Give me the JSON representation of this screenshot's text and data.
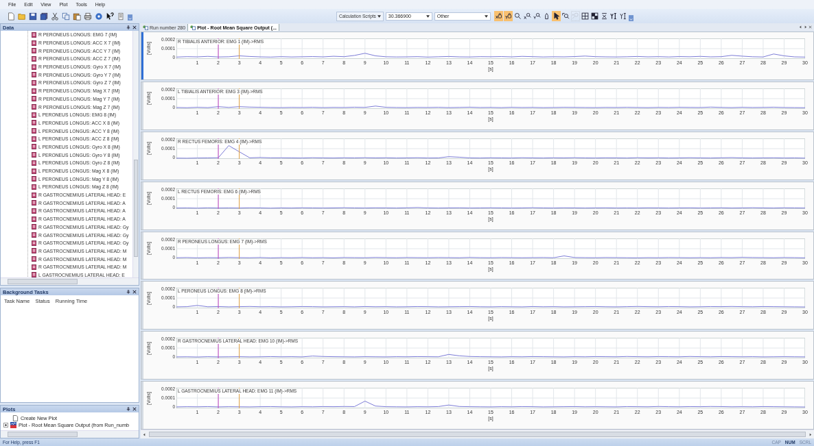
{
  "menu": [
    "File",
    "Edit",
    "View",
    "Plot",
    "Tools",
    "Help"
  ],
  "toolbar": {
    "calc_button": "Calculation Scripts",
    "value_field": "30.366900",
    "dropdown": "Other",
    "tools": [
      {
        "kind": "x-lock",
        "selected": true,
        "disabled": false
      },
      {
        "kind": "y-lock",
        "selected": true,
        "disabled": false
      },
      {
        "kind": "zoom",
        "selected": false,
        "disabled": false
      },
      {
        "kind": "x-zoom",
        "selected": false,
        "disabled": false
      },
      {
        "kind": "y-zoom",
        "selected": false,
        "disabled": false
      },
      {
        "kind": "marker",
        "selected": false,
        "disabled": false
      },
      {
        "kind": "pointer",
        "selected": true,
        "disabled": false
      },
      {
        "kind": "zoom-box",
        "selected": false,
        "disabled": false
      },
      {
        "kind": "zoom-reset",
        "selected": false,
        "disabled": true
      },
      {
        "kind": "grid",
        "selected": false,
        "disabled": false
      },
      {
        "kind": "grid-fill",
        "selected": false,
        "disabled": false
      },
      {
        "kind": "cross",
        "selected": false,
        "disabled": false
      },
      {
        "kind": "y-scale",
        "selected": false,
        "disabled": false
      },
      {
        "kind": "y-scale-alt",
        "selected": false,
        "disabled": false
      }
    ]
  },
  "panels": {
    "data": {
      "title": "Data",
      "items": [
        "R PERONEUS LONGUS: EMG 7 (IM)",
        "R PERONEUS LONGUS: ACC X 7 (IM)",
        "R PERONEUS LONGUS: ACC Y 7 (IM)",
        "R PERONEUS LONGUS: ACC Z 7 (IM)",
        "R PERONEUS LONGUS: Gyro X 7 (IM)",
        "R PERONEUS LONGUS: Gyro Y 7 (IM)",
        "R PERONEUS LONGUS: Gyro Z 7 (IM)",
        "R PERONEUS LONGUS: Mag X 7 (IM)",
        "R PERONEUS LONGUS: Mag Y 7 (IM)",
        "R PERONEUS LONGUS: Mag Z 7 (IM)",
        "L PERONEUS LONGUS: EMG 8 (IM)",
        "L PERONEUS LONGUS: ACC X 8 (IM)",
        "L PERONEUS LONGUS: ACC Y 8 (IM)",
        "L PERONEUS LONGUS: ACC Z 8 (IM)",
        "L PERONEUS LONGUS: Gyro X 8 (IM)",
        "L PERONEUS LONGUS: Gyro Y 8 (IM)",
        "L PERONEUS LONGUS: Gyro Z 8 (IM)",
        "L PERONEUS LONGUS: Mag X 8 (IM)",
        "L PERONEUS LONGUS: Mag Y 8 (IM)",
        "L PERONEUS LONGUS: Mag Z 8 (IM)",
        "R GASTROCNEMIUS LATERAL HEAD: E",
        "R GASTROCNEMIUS LATERAL HEAD: A",
        "R GASTROCNEMIUS LATERAL HEAD: A",
        "R GASTROCNEMIUS LATERAL HEAD: A",
        "R GASTROCNEMIUS LATERAL HEAD: Gy",
        "R GASTROCNEMIUS LATERAL HEAD: Gy",
        "R GASTROCNEMIUS LATERAL HEAD: Gy",
        "R GASTROCNEMIUS LATERAL HEAD: M",
        "R GASTROCNEMIUS LATERAL HEAD: M",
        "R GASTROCNEMIUS LATERAL HEAD: M",
        "L GASTROCNEMIUS LATERAL HEAD: E"
      ]
    },
    "background_tasks": {
      "title": "Background Tasks",
      "columns": [
        "Task Name",
        "Status",
        "Running Time"
      ]
    },
    "plots": {
      "title": "Plots",
      "items": [
        {
          "label": "Create New Plot",
          "kind": "new"
        },
        {
          "label": "Plot - Root Mean Square Output (from Run_numb",
          "kind": "plot"
        }
      ]
    }
  },
  "tabs": [
    {
      "label": "Run number 280",
      "selected": false
    },
    {
      "label": "Plot - Root Mean Square Output (...",
      "selected": true
    }
  ],
  "plots": [
    {
      "selected": true,
      "chart_data": {
        "type": "line",
        "grid": true,
        "xlabel": "[s]",
        "ylabel": "[Volts]",
        "xlim": [
          0,
          30
        ],
        "ylim": [
          0,
          0.0002
        ],
        "xticks": [
          1,
          2,
          3,
          4,
          5,
          6,
          7,
          8,
          9,
          10,
          11,
          12,
          13,
          14,
          15,
          16,
          17,
          18,
          19,
          20,
          21,
          22,
          23,
          24,
          25,
          26,
          27,
          28,
          29,
          30
        ],
        "yticks": [
          0,
          0.0001,
          0.0002
        ],
        "x": [
          0,
          0.5,
          1,
          1.5,
          2,
          2.5,
          3,
          3.5,
          4,
          4.5,
          5,
          5.5,
          6,
          6.5,
          7,
          7.5,
          8,
          8.5,
          9,
          9.5,
          10,
          10.5,
          11,
          11.5,
          12,
          12.5,
          13,
          13.5,
          14,
          14.5,
          15,
          15.5,
          16,
          16.5,
          17,
          17.5,
          18,
          18.5,
          19,
          19.5,
          20,
          20.5,
          21,
          21.5,
          22,
          22.5,
          23,
          23.5,
          24,
          24.5,
          25,
          25.5,
          26,
          26.5,
          27,
          27.5,
          28,
          28.5,
          29,
          29.5,
          30
        ],
        "series": [
          {
            "name": "R TIBIALIS ANTERIOR: EMG 1 (IM)->RMS",
            "color": "#7b7bd6",
            "values": [
              1.8e-05,
              2.2e-05,
              2e-05,
              2.5e-05,
              1.9e-05,
              2.1e-05,
              3e-05,
              2.4e-05,
              2e-05,
              1.8e-05,
              2.2e-05,
              1.9e-05,
              2.1e-05,
              2.3e-05,
              2e-05,
              2.6e-05,
              2.2e-05,
              3.4e-05,
              5.5e-05,
              3e-05,
              2.1e-05,
              1.9e-05,
              2e-05,
              2.2e-05,
              1.8e-05,
              2.1e-05,
              2.4e-05,
              2e-05,
              1.9e-05,
              2.2e-05,
              2.1e-05,
              2.3e-05,
              2e-05,
              2.5e-05,
              2.2e-05,
              1.9e-05,
              2.1e-05,
              2e-05,
              2.3e-05,
              2.8e-05,
              2.2e-05,
              2e-05,
              1.9e-05,
              2.1e-05,
              2.4e-05,
              2e-05,
              2.2e-05,
              1.9e-05,
              2.3e-05,
              2.1e-05,
              2.5e-05,
              2e-05,
              2.2e-05,
              3.5e-05,
              2.7e-05,
              2.1e-05,
              1.9e-05,
              4.8e-05,
              3e-05,
              2e-05,
              1.8e-05
            ]
          }
        ]
      }
    },
    {
      "selected": false,
      "chart_data": {
        "type": "line",
        "xlabel": "[s]",
        "ylabel": "[Volts]",
        "xlim": [
          0,
          30
        ],
        "ylim": [
          0,
          0.0002
        ],
        "xticks": [
          1,
          2,
          3,
          4,
          5,
          6,
          7,
          8,
          9,
          10,
          11,
          12,
          13,
          14,
          15,
          16,
          17,
          18,
          19,
          20,
          21,
          22,
          23,
          24,
          25,
          26,
          27,
          28,
          29,
          30
        ],
        "yticks": [
          0,
          0.0001,
          0.0002
        ],
        "x": [
          0,
          0.5,
          1,
          1.5,
          2,
          2.5,
          3,
          3.5,
          4,
          4.5,
          5,
          5.5,
          6,
          6.5,
          7,
          7.5,
          8,
          8.5,
          9,
          9.5,
          10,
          10.5,
          11,
          11.5,
          12,
          12.5,
          13,
          13.5,
          14,
          14.5,
          15,
          15.5,
          16,
          16.5,
          17,
          17.5,
          18,
          18.5,
          19,
          19.5,
          20,
          20.5,
          21,
          21.5,
          22,
          22.5,
          23,
          23.5,
          24,
          24.5,
          25,
          25.5,
          26,
          26.5,
          27,
          27.5,
          28,
          28.5,
          29,
          29.5,
          30
        ],
        "grid": true,
        "series": [
          {
            "name": "L TIBIALIS ANTERIOR: EMG 3 (IM)->RMS",
            "color": "#7b7bd6",
            "values": [
              1.4e-05,
              1.2e-05,
              1.6e-05,
              1.3e-05,
              2.2e-05,
              1.5e-05,
              2.2e-05,
              1.8e-05,
              1.6e-05,
              1.4e-05,
              1.3e-05,
              1.5e-05,
              1.4e-05,
              1.6e-05,
              1.3e-05,
              1.5e-05,
              1.4e-05,
              1.7e-05,
              1.5e-05,
              2.8e-05,
              1.6e-05,
              1.4e-05,
              1.3e-05,
              1.5e-05,
              1.4e-05,
              1.6e-05,
              1.3e-05,
              1.5e-05,
              1.7e-05,
              1.4e-05,
              1.5e-05,
              1.3e-05,
              1.6e-05,
              1.4e-05,
              1.5e-05,
              1.3e-05,
              1.4e-05,
              1.6e-05,
              1.5e-05,
              1.4e-05,
              1.3e-05,
              1.5e-05,
              1.4e-05,
              1.6e-05,
              1.4e-05,
              1.3e-05,
              1.5e-05,
              1.4e-05,
              1.6e-05,
              1.5e-05,
              1.4e-05,
              1.8e-05,
              1.5e-05,
              1.3e-05,
              1.6e-05,
              1.4e-05,
              1.5e-05,
              1.7e-05,
              1.4e-05,
              1.3e-05,
              1.2e-05
            ]
          }
        ]
      }
    },
    {
      "selected": false,
      "chart_data": {
        "type": "line",
        "xlabel": "[s]",
        "ylabel": "[Volts]",
        "xlim": [
          0,
          30
        ],
        "ylim": [
          0,
          0.0002
        ],
        "xticks": [
          1,
          2,
          3,
          4,
          5,
          6,
          7,
          8,
          9,
          10,
          11,
          12,
          13,
          14,
          15,
          16,
          17,
          18,
          19,
          20,
          21,
          22,
          23,
          24,
          25,
          26,
          27,
          28,
          29,
          30
        ],
        "yticks": [
          0,
          0.0001,
          0.0002
        ],
        "x": [
          0,
          0.5,
          1,
          1.5,
          2,
          2.5,
          3,
          3.5,
          4,
          4.5,
          5,
          5.5,
          6,
          6.5,
          7,
          7.5,
          8,
          8.5,
          9,
          9.5,
          10,
          10.5,
          11,
          11.5,
          12,
          12.5,
          13,
          13.5,
          14,
          14.5,
          15,
          15.5,
          16,
          16.5,
          17,
          17.5,
          18,
          18.5,
          19,
          19.5,
          20,
          20.5,
          21,
          21.5,
          22,
          22.5,
          23,
          23.5,
          24,
          24.5,
          25,
          25.5,
          26,
          26.5,
          27,
          27.5,
          28,
          28.5,
          29,
          29.5,
          30
        ],
        "grid": true,
        "series": [
          {
            "name": "R RECTUS FEMORIS: EMG 4 (IM)->RMS",
            "color": "#7b7bd6",
            "values": [
              8e-06,
              7e-06,
              9e-06,
              1e-05,
              1.2e-05,
              0.00013,
              7e-05,
              1.1e-05,
              1.4e-05,
              1.1e-05,
              1.1e-05,
              1e-05,
              9e-06,
              1.2e-05,
              1e-05,
              9e-06,
              1.1e-05,
              1e-05,
              1.2e-05,
              1e-05,
              1.1e-05,
              9e-06,
              1e-05,
              1.2e-05,
              9e-06,
              1e-05,
              2.2e-05,
              1.7e-05,
              1e-05,
              9e-06,
              1.1e-05,
              1e-05,
              9e-06,
              1.2e-05,
              1e-05,
              9e-06,
              1.1e-05,
              1e-05,
              1.2e-05,
              1e-05,
              9e-06,
              1.1e-05,
              1e-05,
              9e-06,
              1.2e-05,
              1e-05,
              1.1e-05,
              9e-06,
              1e-05,
              1.2e-05,
              1e-05,
              9e-06,
              1.1e-05,
              1.3e-05,
              1e-05,
              9e-06,
              1e-05,
              1.1e-05,
              9e-06,
              1e-05,
              8e-06
            ]
          }
        ]
      }
    },
    {
      "selected": false,
      "chart_data": {
        "type": "line",
        "xlabel": "[s]",
        "ylabel": "[Volts]",
        "xlim": [
          0,
          30
        ],
        "ylim": [
          0,
          0.0002
        ],
        "xticks": [
          1,
          2,
          3,
          4,
          5,
          6,
          7,
          8,
          9,
          10,
          11,
          12,
          13,
          14,
          15,
          16,
          17,
          18,
          19,
          20,
          21,
          22,
          23,
          24,
          25,
          26,
          27,
          28,
          29,
          30
        ],
        "yticks": [
          0,
          0.0001,
          0.0002
        ],
        "x": [
          0,
          0.5,
          1,
          1.5,
          2,
          2.5,
          3,
          3.5,
          4,
          4.5,
          5,
          5.5,
          6,
          6.5,
          7,
          7.5,
          8,
          8.5,
          9,
          9.5,
          10,
          10.5,
          11,
          11.5,
          12,
          12.5,
          13,
          13.5,
          14,
          14.5,
          15,
          15.5,
          16,
          16.5,
          17,
          17.5,
          18,
          18.5,
          19,
          19.5,
          20,
          20.5,
          21,
          21.5,
          22,
          22.5,
          23,
          23.5,
          24,
          24.5,
          25,
          25.5,
          26,
          26.5,
          27,
          27.5,
          28,
          28.5,
          29,
          29.5,
          30
        ],
        "grid": true,
        "series": [
          {
            "name": "L RECTUS FEMORIS: EMG 6 (IM)->RMS",
            "color": "#7b7bd6",
            "values": [
              9e-06,
              1e-05,
              8e-06,
              1.1e-05,
              9e-06,
              1e-05,
              9e-06,
              1.1e-05,
              1e-05,
              8e-06,
              1e-05,
              9e-06,
              1.1e-05,
              1e-05,
              9e-06,
              1e-05,
              1.2e-05,
              1e-05,
              9e-06,
              1.1e-05,
              1e-05,
              9e-06,
              1.1e-05,
              1.4e-05,
              1e-05,
              9e-06,
              1e-05,
              1.1e-05,
              9e-06,
              1e-05,
              1.1e-05,
              1e-05,
              9e-06,
              1e-05,
              1.2e-05,
              1e-05,
              9e-06,
              1.1e-05,
              1e-05,
              9e-06,
              1e-05,
              1.1e-05,
              9e-06,
              1e-05,
              9e-06,
              1.1e-05,
              1e-05,
              9e-06,
              1e-05,
              1.1e-05,
              9e-06,
              1e-05,
              1.1e-05,
              9e-06,
              1e-05,
              1.2e-05,
              1e-05,
              9e-06,
              1.1e-05,
              1e-05,
              9e-06
            ]
          }
        ]
      }
    },
    {
      "selected": false,
      "chart_data": {
        "type": "line",
        "xlabel": "[s]",
        "ylabel": "[Volts]",
        "xlim": [
          0,
          30
        ],
        "ylim": [
          0,
          0.0002
        ],
        "xticks": [
          1,
          2,
          3,
          4,
          5,
          6,
          7,
          8,
          9,
          10,
          11,
          12,
          13,
          14,
          15,
          16,
          17,
          18,
          19,
          20,
          21,
          22,
          23,
          24,
          25,
          26,
          27,
          28,
          29,
          30
        ],
        "yticks": [
          0,
          0.0001,
          0.0002
        ],
        "x": [
          0,
          0.5,
          1,
          1.5,
          2,
          2.5,
          3,
          3.5,
          4,
          4.5,
          5,
          5.5,
          6,
          6.5,
          7,
          7.5,
          8,
          8.5,
          9,
          9.5,
          10,
          10.5,
          11,
          11.5,
          12,
          12.5,
          13,
          13.5,
          14,
          14.5,
          15,
          15.5,
          16,
          16.5,
          17,
          17.5,
          18,
          18.5,
          19,
          19.5,
          20,
          20.5,
          21,
          21.5,
          22,
          22.5,
          23,
          23.5,
          24,
          24.5,
          25,
          25.5,
          26,
          26.5,
          27,
          27.5,
          28,
          28.5,
          29,
          29.5,
          30
        ],
        "grid": true,
        "series": [
          {
            "name": "R PERONEUS LONGUS: EMG 7 (IM)->RMS",
            "color": "#7b7bd6",
            "values": [
              1.2e-05,
              1.4e-05,
              1.1e-05,
              1.3e-05,
              1.2e-05,
              1.5e-05,
              1.3e-05,
              1.2e-05,
              1.4e-05,
              1.1e-05,
              1.3e-05,
              1.2e-05,
              1.4e-05,
              1.2e-05,
              1.3e-05,
              1.1e-05,
              1.4e-05,
              1.3e-05,
              1.2e-05,
              1.5e-05,
              1.3e-05,
              1.2e-05,
              1.4e-05,
              1.3e-05,
              1.2e-05,
              1.4e-05,
              1.3e-05,
              1.2e-05,
              1.5e-05,
              1.3e-05,
              1.2e-05,
              1.4e-05,
              1.3e-05,
              1.2e-05,
              1.3e-05,
              1.4e-05,
              1.2e-05,
              3e-05,
              1.4e-05,
              1.3e-05,
              1.2e-05,
              1.4e-05,
              1.3e-05,
              1.2e-05,
              1.1e-05,
              1.3e-05,
              1.2e-05,
              1.4e-05,
              1.3e-05,
              1.2e-05,
              1.3e-05,
              1.2e-05,
              1.4e-05,
              1.3e-05,
              1.6e-05,
              1.4e-05,
              1.3e-05,
              1.2e-05,
              1.4e-05,
              1.3e-05,
              1.1e-05
            ]
          }
        ]
      }
    },
    {
      "selected": false,
      "chart_data": {
        "type": "line",
        "xlabel": "[s]",
        "ylabel": "[Volts]",
        "xlim": [
          0,
          30
        ],
        "ylim": [
          0,
          0.0002
        ],
        "xticks": [
          1,
          2,
          3,
          4,
          5,
          6,
          7,
          8,
          9,
          10,
          11,
          12,
          13,
          14,
          15,
          16,
          17,
          18,
          19,
          20,
          21,
          22,
          23,
          24,
          25,
          26,
          27,
          28,
          29,
          30
        ],
        "yticks": [
          0,
          0.0001,
          0.0002
        ],
        "x": [
          0,
          0.5,
          1,
          1.5,
          2,
          2.5,
          3,
          3.5,
          4,
          4.5,
          5,
          5.5,
          6,
          6.5,
          7,
          7.5,
          8,
          8.5,
          9,
          9.5,
          10,
          10.5,
          11,
          11.5,
          12,
          12.5,
          13,
          13.5,
          14,
          14.5,
          15,
          15.5,
          16,
          16.5,
          17,
          17.5,
          18,
          18.5,
          19,
          19.5,
          20,
          20.5,
          21,
          21.5,
          22,
          22.5,
          23,
          23.5,
          24,
          24.5,
          25,
          25.5,
          26,
          26.5,
          27,
          27.5,
          28,
          28.5,
          29,
          29.5,
          30
        ],
        "grid": true,
        "series": [
          {
            "name": "L PERONEUS LONGUS: EMG 8 (IM)->RMS",
            "color": "#7b7bd6",
            "values": [
              1.4e-05,
              1.6e-05,
              2.8e-05,
              1.5e-05,
              1.7e-05,
              1.4e-05,
              1.6e-05,
              1.8e-05,
              1.5e-05,
              1.6e-05,
              1.4e-05,
              1.5e-05,
              1.7e-05,
              1.6e-05,
              1.4e-05,
              1.5e-05,
              1.6e-05,
              1.4e-05,
              1.7e-05,
              1.5e-05,
              1.6e-05,
              1.4e-05,
              1.5e-05,
              1.7e-05,
              1.6e-05,
              1.4e-05,
              1.5e-05,
              1.6e-05,
              1.7e-05,
              1.5e-05,
              1.4e-05,
              1.6e-05,
              1.5e-05,
              1.4e-05,
              1.7e-05,
              1.5e-05,
              1.6e-05,
              1.4e-05,
              1.5e-05,
              1.6e-05,
              1.7e-05,
              1.5e-05,
              1.4e-05,
              1.6e-05,
              1.8e-05,
              1.6e-05,
              1.5e-05,
              1.7e-05,
              1.6e-05,
              1.4e-05,
              1.5e-05,
              1.7e-05,
              1.6e-05,
              1.8e-05,
              1.6e-05,
              1.5e-05,
              1.7e-05,
              1.6e-05,
              1.5e-05,
              1.4e-05,
              1.3e-05
            ]
          }
        ]
      }
    },
    {
      "selected": false,
      "chart_data": {
        "type": "line",
        "xlabel": "[s]",
        "ylabel": "[Volts]",
        "xlim": [
          0,
          30
        ],
        "ylim": [
          0,
          0.0002
        ],
        "xticks": [
          1,
          2,
          3,
          4,
          5,
          6,
          7,
          8,
          9,
          10,
          11,
          12,
          13,
          14,
          15,
          16,
          17,
          18,
          19,
          20,
          21,
          22,
          23,
          24,
          25,
          26,
          27,
          28,
          29,
          30
        ],
        "yticks": [
          0,
          0.0001,
          0.0002
        ],
        "x": [
          0,
          0.5,
          1,
          1.5,
          2,
          2.5,
          3,
          3.5,
          4,
          4.5,
          5,
          5.5,
          6,
          6.5,
          7,
          7.5,
          8,
          8.5,
          9,
          9.5,
          10,
          10.5,
          11,
          11.5,
          12,
          12.5,
          13,
          13.5,
          14,
          14.5,
          15,
          15.5,
          16,
          16.5,
          17,
          17.5,
          18,
          18.5,
          19,
          19.5,
          20,
          20.5,
          21,
          21.5,
          22,
          22.5,
          23,
          23.5,
          24,
          24.5,
          25,
          25.5,
          26,
          26.5,
          27,
          27.5,
          28,
          28.5,
          29,
          29.5,
          30
        ],
        "grid": true,
        "series": [
          {
            "name": "R GASTROCNEMIUS LATERAL HEAD: EMG 10 (IM)->RMS",
            "color": "#7b7bd6",
            "values": [
              1.4e-05,
              1.5e-05,
              1.3e-05,
              1.6e-05,
              1.4e-05,
              1.5e-05,
              1.6e-05,
              1.4e-05,
              1.5e-05,
              1.7e-05,
              1.5e-05,
              1.6e-05,
              1.4e-05,
              2.2e-05,
              1.8e-05,
              1.6e-05,
              1.5e-05,
              1.4e-05,
              1.6e-05,
              1.5e-05,
              1.4e-05,
              1.6e-05,
              1.5e-05,
              1.7e-05,
              1.6e-05,
              1.5e-05,
              3.8e-05,
              2.4e-05,
              1.8e-05,
              1.6e-05,
              1.5e-05,
              1.4e-05,
              1.6e-05,
              1.5e-05,
              1.7e-05,
              1.6e-05,
              1.5e-05,
              1.4e-05,
              1.6e-05,
              1.5e-05,
              1.7e-05,
              1.6e-05,
              1.5e-05,
              1.8e-05,
              1.6e-05,
              1.5e-05,
              1.7e-05,
              1.6e-05,
              1.5e-05,
              1.8e-05,
              1.6e-05,
              1.5e-05,
              1.7e-05,
              1.6e-05,
              1.5e-05,
              1.6e-05,
              1.4e-05,
              1.5e-05,
              1.6e-05,
              1.5e-05,
              1.4e-05
            ]
          }
        ]
      }
    },
    {
      "selected": false,
      "chart_data": {
        "type": "line",
        "xlabel": "[s]",
        "ylabel": "[Volts]",
        "xlim": [
          0,
          30
        ],
        "ylim": [
          0,
          0.0002
        ],
        "xticks": [
          1,
          2,
          3,
          4,
          5,
          6,
          7,
          8,
          9,
          10,
          11,
          12,
          13,
          14,
          15,
          16,
          17,
          18,
          19,
          20,
          21,
          22,
          23,
          24,
          25,
          26,
          27,
          28,
          29,
          30
        ],
        "yticks": [
          0,
          0.0001,
          0.0002
        ],
        "x": [
          0,
          0.5,
          1,
          1.5,
          2,
          2.5,
          3,
          3.5,
          4,
          4.5,
          5,
          5.5,
          6,
          6.5,
          7,
          7.5,
          8,
          8.5,
          9,
          9.5,
          10,
          10.5,
          11,
          11.5,
          12,
          12.5,
          13,
          13.5,
          14,
          14.5,
          15,
          15.5,
          16,
          16.5,
          17,
          17.5,
          18,
          18.5,
          19,
          19.5,
          20,
          20.5,
          21,
          21.5,
          22,
          22.5,
          23,
          23.5,
          24,
          24.5,
          25,
          25.5,
          26,
          26.5,
          27,
          27.5,
          28,
          28.5,
          29,
          29.5,
          30
        ],
        "grid": true,
        "series": [
          {
            "name": "L GASTROCNEMIUS LATERAL HEAD: EMG 11 (IM)->RMS",
            "color": "#7b7bd6",
            "values": [
              1.4e-05,
              1.6e-05,
              1.5e-05,
              1.7e-05,
              1.4e-05,
              1.6e-05,
              1.5e-05,
              1.4e-05,
              1.6e-05,
              1.7e-05,
              1.5e-05,
              1.4e-05,
              1.6e-05,
              1.5e-05,
              1.7e-05,
              1.6e-05,
              1.8e-05,
              1.7e-05,
              7e-05,
              2.2e-05,
              1.6e-05,
              1.5e-05,
              1.4e-05,
              1.6e-05,
              1.5e-05,
              1.7e-05,
              3.2e-05,
              1.8e-05,
              1.6e-05,
              1.5e-05,
              1.4e-05,
              1.6e-05,
              1.5e-05,
              1.7e-05,
              1.6e-05,
              1.4e-05,
              1.5e-05,
              1.6e-05,
              1.7e-05,
              1.5e-05,
              1.6e-05,
              1.5e-05,
              1.4e-05,
              1.7e-05,
              1.6e-05,
              1.5e-05,
              1.8e-05,
              1.6e-05,
              1.5e-05,
              1.7e-05,
              1.6e-05,
              1.8e-05,
              1.7e-05,
              1.5e-05,
              1.6e-05,
              1.5e-05,
              1.7e-05,
              1.6e-05,
              1.5e-05,
              1.4e-05,
              1.3e-05
            ]
          }
        ]
      }
    }
  ],
  "status_bar": {
    "text": "For Help, press F1",
    "indicators": [
      {
        "label": "CAP",
        "on": false
      },
      {
        "label": "NUM",
        "on": true
      },
      {
        "label": "SCRL",
        "on": false
      }
    ]
  }
}
